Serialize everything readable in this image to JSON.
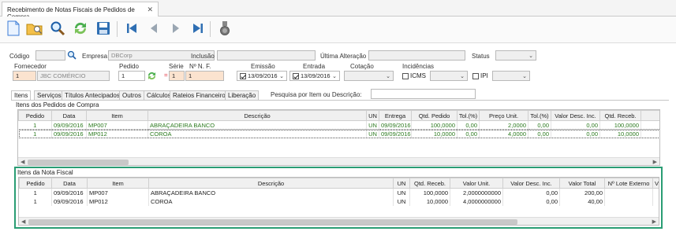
{
  "document_tab": {
    "title": "Recebimento de Notas Fiscais de Pedidos de Compra",
    "close": "✕"
  },
  "toolbar": {
    "buttons": [
      "new-icon",
      "open-folder-icon",
      "search-icon",
      "refresh-icon",
      "save-icon",
      "first-record-icon",
      "previous-record-icon",
      "next-record-icon",
      "last-record-icon",
      "medal-icon"
    ]
  },
  "form": {
    "codigo_label": "Código",
    "empresa_label": "Empresa",
    "empresa_value": "DBCorp",
    "inclusao_label": "Inclusão",
    "ultima_alteracao_label": "Última Alteração",
    "status_label": "Status",
    "fornecedor_label": "Fornecedor",
    "fornecedor_code": "1",
    "fornecedor_name": "JBC COMÉRCIO",
    "pedido_label": "Pedido",
    "pedido_value": "1",
    "serie_label": "Série",
    "serie_value": "1",
    "nf_label": "Nº N. F.",
    "nf_value": "1",
    "emissao_label": "Emissão",
    "emissao_value": "13/09/2016",
    "entrada_label": "Entrada",
    "entrada_value": "13/09/2016",
    "cotacao_label": "Cotação",
    "incidencias_label": "Incidências",
    "icms_label": "ICMS",
    "ipi_label": "IPI",
    "required_marker": "="
  },
  "tabs": [
    "Itens",
    "Serviços",
    "Títulos Antecipados",
    "Outros",
    "Cálculos",
    "Rateios Financeiros",
    "Liberação"
  ],
  "search_label": "Pesquisa por Item ou Descrição:",
  "pedidos_grid": {
    "title": "Itens dos Pedidos de Compra",
    "headers": [
      "Pedido",
      "Data",
      "Item",
      "Descrição",
      "UN",
      "Entrega",
      "Qtd. Pedido",
      "Tol.(%)",
      "Preço Unit.",
      "Tol.(%)",
      "Valor Desc. Inc.",
      "Qtd. Receb."
    ],
    "rows": [
      [
        "1",
        "09/09/2016",
        "MP007",
        "ABRAÇADEIRA BANCO",
        "UN",
        "09/09/2016",
        "100,0000",
        "0,00",
        "2,0000",
        "0,00",
        "0,00",
        "100,0000"
      ],
      [
        "1",
        "09/09/2016",
        "MP012",
        "COROA",
        "UN",
        "09/09/2016",
        "10,0000",
        "0,00",
        "4,0000",
        "0,00",
        "0,00",
        "10,0000"
      ]
    ]
  },
  "nota_grid": {
    "title": "Itens da Nota Fiscal",
    "headers": [
      "Pedido",
      "Data",
      "Item",
      "Descrição",
      "UN",
      "Qtd. Receb.",
      "Valor Unit.",
      "Valor Desc. Inc.",
      "Valor Total",
      "Nº Lote Externo",
      "V"
    ],
    "rows": [
      [
        "1",
        "09/09/2016",
        "MP007",
        "ABRAÇADEIRA BANCO",
        "UN",
        "100,0000",
        "2,0000000000",
        "0,00",
        "200,00",
        "",
        ""
      ],
      [
        "1",
        "09/09/2016",
        "MP012",
        "COROA",
        "UN",
        "10,0000",
        "4,0000000000",
        "0,00",
        "40,00",
        "",
        ""
      ]
    ]
  },
  "colors": {
    "accent_border": "#2a9d74",
    "green_text": "#2b7a1e",
    "peach": "#fbe3cf"
  }
}
